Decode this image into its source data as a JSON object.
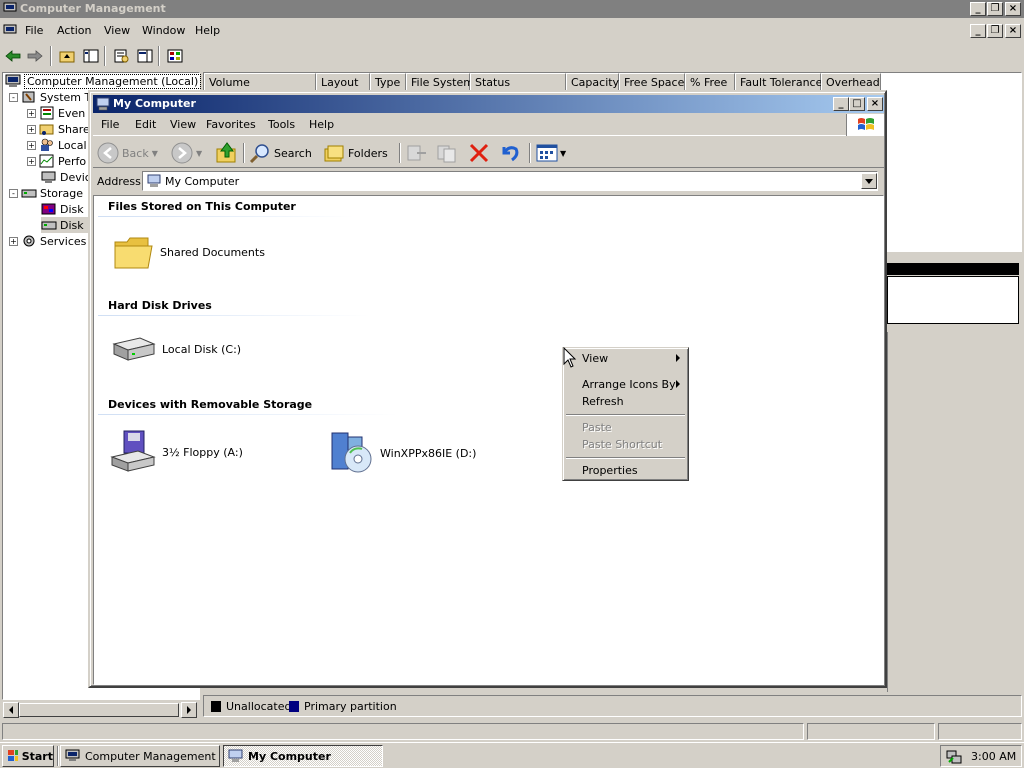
{
  "mmc": {
    "title": "Computer Management",
    "menu": [
      "File",
      "Action",
      "View",
      "Window",
      "Help"
    ],
    "tree": {
      "root": "Computer Management (Local)",
      "items": [
        {
          "label": "System T",
          "level": 1,
          "expander": "-"
        },
        {
          "label": "Even",
          "level": 2,
          "expander": "+"
        },
        {
          "label": "Share",
          "level": 2,
          "expander": "+"
        },
        {
          "label": "Local",
          "level": 2,
          "expander": "+"
        },
        {
          "label": "Perfo",
          "level": 2,
          "expander": "+"
        },
        {
          "label": "Devic",
          "level": 2,
          "expander": ""
        },
        {
          "label": "Storage",
          "level": 1,
          "expander": "-"
        },
        {
          "label": "Disk D",
          "level": 2,
          "expander": ""
        },
        {
          "label": "Disk M",
          "level": 2,
          "expander": ""
        },
        {
          "label": "Services",
          "level": 1,
          "expander": "+"
        }
      ]
    },
    "columns": [
      "Volume",
      "Layout",
      "Type",
      "File System",
      "Status",
      "Capacity",
      "Free Space",
      "% Free",
      "Fault Tolerance",
      "Overhead"
    ],
    "legend": {
      "unallocated": "Unallocated",
      "primary": "Primary partition"
    }
  },
  "explorer": {
    "title": "My Computer",
    "menu": [
      "File",
      "Edit",
      "View",
      "Favorites",
      "Tools",
      "Help"
    ],
    "toolbar": {
      "back": "Back",
      "search": "Search",
      "folders": "Folders"
    },
    "address_label": "Address",
    "address_value": "My Computer",
    "groups": {
      "files": {
        "header": "Files Stored on This Computer",
        "items": [
          "Shared Documents"
        ]
      },
      "hdd": {
        "header": "Hard Disk Drives",
        "items": [
          "Local Disk (C:)"
        ]
      },
      "removable": {
        "header": "Devices with Removable Storage",
        "items": [
          "3½ Floppy (A:)",
          "WinXPPx86IE (D:)"
        ]
      }
    }
  },
  "context_menu": {
    "items": [
      {
        "label": "View",
        "submenu": true,
        "enabled": true
      },
      {
        "label": "Arrange Icons By",
        "submenu": true,
        "enabled": true
      },
      {
        "label": "Refresh",
        "submenu": false,
        "enabled": true
      },
      {
        "label": "Paste",
        "submenu": false,
        "enabled": false
      },
      {
        "label": "Paste Shortcut",
        "submenu": false,
        "enabled": false
      },
      {
        "label": "Properties",
        "submenu": false,
        "enabled": true
      }
    ]
  },
  "taskbar": {
    "start": "Start",
    "tasks": [
      "Computer Management",
      "My Computer"
    ],
    "clock": "3:00 AM"
  },
  "colors": {
    "titlebar_active": "#0a246a",
    "titlebar_inactive": "#808080",
    "face": "#d4d0c8"
  }
}
